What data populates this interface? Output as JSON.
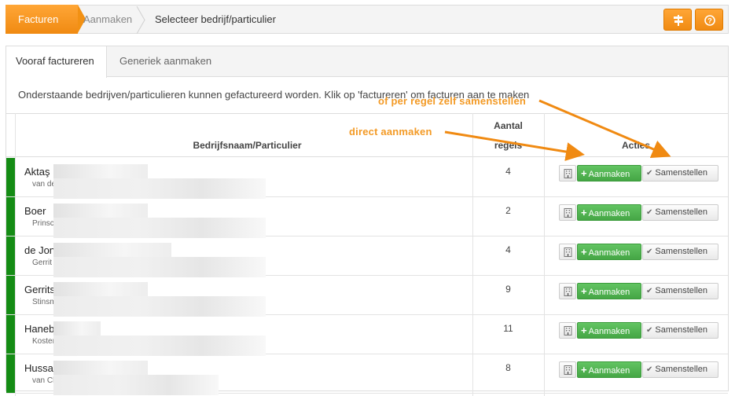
{
  "breadcrumb": {
    "items": [
      "Facturen",
      "Aanmaken",
      "Selecteer bedrijf/particulier"
    ]
  },
  "toolbar": {
    "buttons": [
      {
        "icon": "signpost-icon"
      },
      {
        "icon": "help-icon"
      }
    ]
  },
  "tabs": [
    {
      "label": "Vooraf factureren",
      "active": true
    },
    {
      "label": "Generiek aanmaken",
      "active": false
    }
  ],
  "info_text": "Onderstaande bedrijven/particulieren kunnen gefactureerd worden. Klik op 'factureren' om facturen aan te maken",
  "table": {
    "headers": {
      "name": "Bedrijfsnaam/Particulier",
      "count_line1": "Aantal",
      "count_line2": "regels",
      "actions": "Acties"
    },
    "rows": [
      {
        "name": "Aktaş",
        "addr": "van de",
        "count": "4"
      },
      {
        "name": "Boer",
        "addr": "Prinsc",
        "count": "2"
      },
      {
        "name": "de Jon",
        "addr": "Gerrit",
        "count": "4"
      },
      {
        "name": "Gerrits",
        "addr": "Stinsm",
        "count": "9"
      },
      {
        "name": "Haneb",
        "addr": "Koster",
        "count": "11"
      },
      {
        "name": "Hussa",
        "addr": "van Cl",
        "count": "8"
      }
    ],
    "add_label": "Aanmaken",
    "compose_label": "Samenstellen"
  },
  "annotations": {
    "direct": "direct aanmaken",
    "per_row": "of per regel zelf samenstellen"
  },
  "colors": {
    "orange": "#f29114",
    "green": "#148c14",
    "button_green": "#51b751"
  }
}
